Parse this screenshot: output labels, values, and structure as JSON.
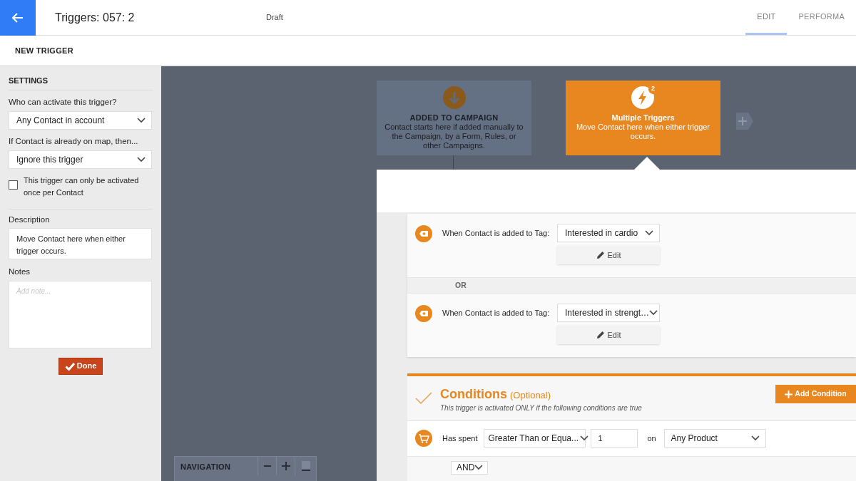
{
  "header": {
    "title": "Triggers: 057: 2",
    "status": "Draft",
    "tabs": [
      {
        "label": "EDIT",
        "selected": true
      },
      {
        "label": "PERFORMA",
        "selected": false
      }
    ]
  },
  "subheader": {
    "title": "NEW TRIGGER"
  },
  "settings": {
    "heading": "SETTINGS",
    "selects": [
      {
        "label": "Who can activate this trigger?",
        "value": "Any Contact in account"
      },
      {
        "label": "If Contact is already on map, then...",
        "value": "Ignore this trigger"
      }
    ],
    "once_checkbox": {
      "label": "This trigger can only be activated once per Contact",
      "checked": false
    },
    "description": {
      "label": "Description",
      "value": "Move Contact here when either trigger occurs."
    },
    "notes": {
      "label": "Notes",
      "placeholder": "Add note..."
    },
    "done_button": "Done"
  },
  "canvas": {
    "nodes": [
      {
        "kind": "start",
        "title": "ADDED TO CAMPAIGN",
        "text": "Contact starts here if added manually to the Campaign, by a Form, Rules, or other Campaigns.",
        "selected": false
      },
      {
        "kind": "trigger",
        "title": "Multiple Triggers",
        "text": "Move Contact here when either trigger occurs.",
        "badge": "2",
        "selected": true
      }
    ],
    "triggers": [
      {
        "label": "When Contact is added to Tag:",
        "value": "Interested in cardio",
        "edit": "Edit"
      },
      {
        "label": "When Contact is added to Tag:",
        "value": "Interested in strengt…",
        "edit": "Edit"
      }
    ],
    "joiner": "OR",
    "conditions": {
      "title": "Conditions",
      "title_note": "(Optional)",
      "subtitle": "This trigger is activated ONLY if the following conditions are true",
      "add_button": "Add Condition",
      "rows": [
        {
          "label": "Has spent",
          "operator": "Greater Than or Equa...",
          "amount": "1",
          "on": "on",
          "product": "Any Product"
        }
      ],
      "joiner": "AND"
    },
    "navigation": {
      "title": "NAVIGATION"
    }
  }
}
